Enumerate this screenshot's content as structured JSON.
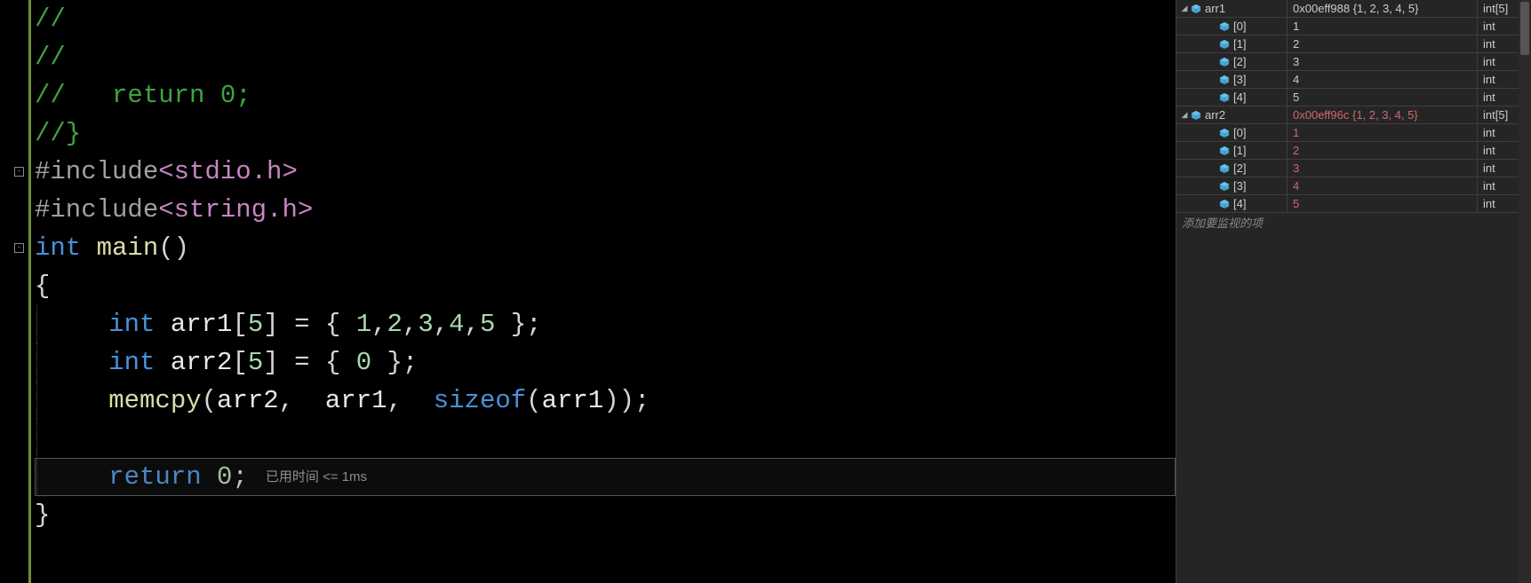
{
  "code": {
    "lines": [
      {
        "tokens": [
          {
            "t": "//",
            "c": "c-comment"
          }
        ]
      },
      {
        "tokens": [
          {
            "t": "//",
            "c": "c-comment"
          }
        ]
      },
      {
        "tokens": [
          {
            "t": "//   return 0;",
            "c": "c-comment"
          }
        ]
      },
      {
        "tokens": [
          {
            "t": "//}",
            "c": "c-comment"
          }
        ]
      },
      {
        "fold": "-",
        "tokens": [
          {
            "t": "#include",
            "c": "c-preproc"
          },
          {
            "t": "<stdio.h>",
            "c": "c-include-file"
          }
        ]
      },
      {
        "tokens": [
          {
            "t": "#include",
            "c": "c-preproc"
          },
          {
            "t": "<string.h>",
            "c": "c-include-file"
          }
        ]
      },
      {
        "fold": "-",
        "tokens": [
          {
            "t": "int ",
            "c": "c-keyword"
          },
          {
            "t": "main",
            "c": "c-func"
          },
          {
            "t": "()",
            "c": "c-punct"
          }
        ]
      },
      {
        "tokens": [
          {
            "t": "{",
            "c": "c-punct"
          }
        ]
      },
      {
        "guide": true,
        "tokens": [
          {
            "t": "int ",
            "c": "c-keyword"
          },
          {
            "t": "arr1",
            "c": "c-ident"
          },
          {
            "t": "[",
            "c": "c-punct"
          },
          {
            "t": "5",
            "c": "c-num"
          },
          {
            "t": "] = { ",
            "c": "c-punct"
          },
          {
            "t": "1",
            "c": "c-num"
          },
          {
            "t": ",",
            "c": "c-punct"
          },
          {
            "t": "2",
            "c": "c-num"
          },
          {
            "t": ",",
            "c": "c-punct"
          },
          {
            "t": "3",
            "c": "c-num"
          },
          {
            "t": ",",
            "c": "c-punct"
          },
          {
            "t": "4",
            "c": "c-num"
          },
          {
            "t": ",",
            "c": "c-punct"
          },
          {
            "t": "5",
            "c": "c-num"
          },
          {
            "t": " };",
            "c": "c-punct"
          }
        ]
      },
      {
        "guide": true,
        "tokens": [
          {
            "t": "int ",
            "c": "c-keyword"
          },
          {
            "t": "arr2",
            "c": "c-ident"
          },
          {
            "t": "[",
            "c": "c-punct"
          },
          {
            "t": "5",
            "c": "c-num"
          },
          {
            "t": "] = { ",
            "c": "c-punct"
          },
          {
            "t": "0",
            "c": "c-num"
          },
          {
            "t": " };",
            "c": "c-punct"
          }
        ]
      },
      {
        "guide": true,
        "tokens": [
          {
            "t": "memcpy",
            "c": "c-func"
          },
          {
            "t": "(",
            "c": "c-punct"
          },
          {
            "t": "arr2",
            "c": "c-ident"
          },
          {
            "t": ",  ",
            "c": "c-punct"
          },
          {
            "t": "arr1",
            "c": "c-ident"
          },
          {
            "t": ",  ",
            "c": "c-punct"
          },
          {
            "t": "sizeof",
            "c": "c-keyword"
          },
          {
            "t": "(",
            "c": "c-punct"
          },
          {
            "t": "arr1",
            "c": "c-ident"
          },
          {
            "t": "));",
            "c": "c-punct"
          }
        ]
      },
      {
        "guide": true,
        "tokens": []
      },
      {
        "guide": true,
        "highlight": true,
        "tokens": [
          {
            "t": "return ",
            "c": "c-keyword"
          },
          {
            "t": "0",
            "c": "c-num"
          },
          {
            "t": ";",
            "c": "c-punct"
          }
        ],
        "perf": "已用时间 <= 1ms"
      },
      {
        "tokens": [
          {
            "t": "}",
            "c": "c-punct"
          }
        ]
      }
    ]
  },
  "watch": {
    "rows": [
      {
        "depth": 0,
        "expanded": true,
        "name": "arr1",
        "value": "0x00eff988 {1, 2, 3, 4, 5}",
        "type": "int[5]",
        "changed": false
      },
      {
        "depth": 1,
        "expanded": null,
        "name": "[0]",
        "value": "1",
        "type": "int",
        "changed": false
      },
      {
        "depth": 1,
        "expanded": null,
        "name": "[1]",
        "value": "2",
        "type": "int",
        "changed": false
      },
      {
        "depth": 1,
        "expanded": null,
        "name": "[2]",
        "value": "3",
        "type": "int",
        "changed": false
      },
      {
        "depth": 1,
        "expanded": null,
        "name": "[3]",
        "value": "4",
        "type": "int",
        "changed": false
      },
      {
        "depth": 1,
        "expanded": null,
        "name": "[4]",
        "value": "5",
        "type": "int",
        "changed": false
      },
      {
        "depth": 0,
        "expanded": true,
        "name": "arr2",
        "value": "0x00eff96c {1, 2, 3, 4, 5}",
        "type": "int[5]",
        "changed": true
      },
      {
        "depth": 1,
        "expanded": null,
        "name": "[0]",
        "value": "1",
        "type": "int",
        "changed": true
      },
      {
        "depth": 1,
        "expanded": null,
        "name": "[1]",
        "value": "2",
        "type": "int",
        "changed": true
      },
      {
        "depth": 1,
        "expanded": null,
        "name": "[2]",
        "value": "3",
        "type": "int",
        "changed": true
      },
      {
        "depth": 1,
        "expanded": null,
        "name": "[3]",
        "value": "4",
        "type": "int",
        "changed": true
      },
      {
        "depth": 1,
        "expanded": null,
        "name": "[4]",
        "value": "5",
        "type": "int",
        "changed": true
      }
    ],
    "add_placeholder": "添加要监视的项"
  },
  "glyphs": {
    "fold_collapsed": "+",
    "fold_expanded": "-",
    "tri_expanded": "◢",
    "tri_collapsed": "▷"
  }
}
